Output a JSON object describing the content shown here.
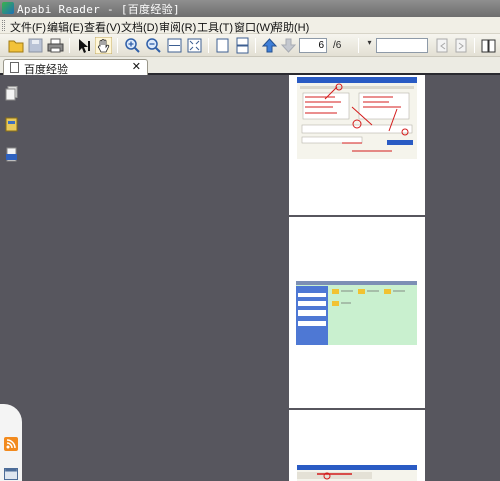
{
  "window": {
    "title": "Apabi Reader - [百度经验]"
  },
  "menu": [
    "文件(F)",
    "编辑(E)",
    "查看(V)",
    "文档(D)",
    "审阅(R)",
    "工具(T)",
    "窗口(W)",
    "帮助(H)"
  ],
  "toolbar": {
    "page_current": "6",
    "page_total": "/6",
    "combo_arrow": "▾",
    "search_value": ""
  },
  "tab": {
    "label": "百度经验",
    "close": "✕"
  },
  "icons": {
    "open": "folder-open-icon",
    "save": "save-icon",
    "print": "print-icon",
    "select": "select-arrow-icon",
    "hand": "hand-icon",
    "zoom_in": "zoom-in-icon",
    "zoom_out": "zoom-out-icon",
    "fit_width": "fit-width-icon",
    "fit_page": "fit-page-icon",
    "single_page": "single-page-icon",
    "continuous": "continuous-page-icon",
    "prev_page": "arrow-up-icon",
    "next_page": "arrow-down-icon"
  },
  "colors": {
    "workspace": "#57565e",
    "toolbar": "#f1efe6",
    "accent_blue": "#1f60c8",
    "annotation_red": "#d41c1c",
    "sheet_green": "#c9f0cf"
  }
}
